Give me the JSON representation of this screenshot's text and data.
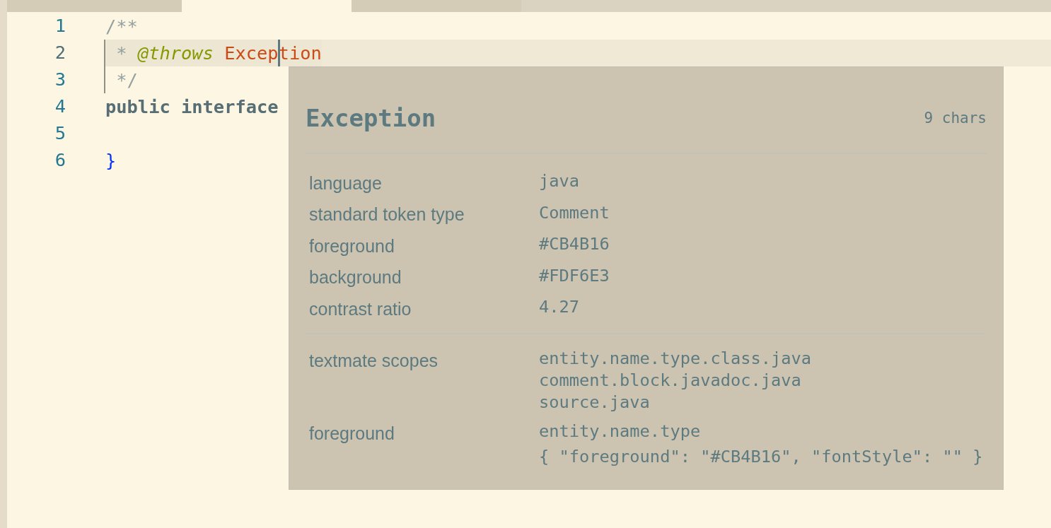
{
  "tab_bar": {
    "tabs": [
      {
        "selected": false
      },
      {
        "selected": true
      },
      {
        "selected": false
      }
    ]
  },
  "editor": {
    "lines": [
      {
        "number": "1",
        "current": false,
        "guide": false,
        "tokens": [
          {
            "kind": "comment",
            "text": "/**"
          }
        ]
      },
      {
        "number": "2",
        "current": true,
        "guide": true,
        "tokens": [
          {
            "kind": "comment",
            "text": " * "
          },
          {
            "kind": "tag",
            "text": "@throws "
          },
          {
            "kind": "type",
            "text": "Excep"
          },
          {
            "kind": "cursor"
          },
          {
            "kind": "type",
            "text": "tion"
          }
        ]
      },
      {
        "number": "3",
        "current": false,
        "guide": true,
        "tokens": [
          {
            "kind": "comment",
            "text": " */"
          }
        ]
      },
      {
        "number": "4",
        "current": false,
        "guide": false,
        "tokens": [
          {
            "kind": "keyword",
            "text": "public interface"
          }
        ]
      },
      {
        "number": "5",
        "current": false,
        "guide": false
      },
      {
        "number": "6",
        "current": false,
        "guide": false,
        "tokens": [
          {
            "kind": "bracket",
            "text": "}"
          }
        ]
      }
    ]
  },
  "hover": {
    "title": "Exception",
    "length": "9 chars",
    "info": [
      {
        "label": "language",
        "value": "java"
      },
      {
        "label": "standard token type",
        "value": "Comment"
      },
      {
        "label": "foreground",
        "value": "#CB4B16"
      },
      {
        "label": "background",
        "value": "#FDF6E3"
      },
      {
        "label": "contrast ratio",
        "value": "4.27"
      }
    ],
    "scopes": [
      {
        "label": "textmate scopes",
        "values": [
          "entity.name.type.class.java",
          "comment.block.javadoc.java",
          "source.java"
        ]
      },
      {
        "label": "foreground",
        "values": [
          "entity.name.type"
        ],
        "rule": "{ \"foreground\": \"#CB4B16\", \"fontStyle\": \"\" }"
      }
    ]
  }
}
